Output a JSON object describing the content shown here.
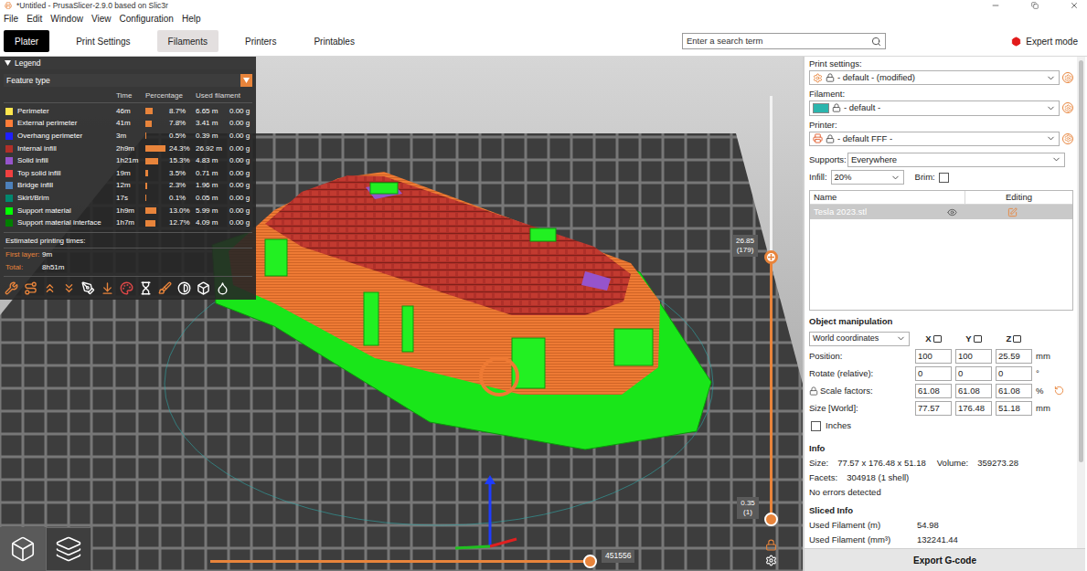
{
  "window": {
    "title": "*Untitled - PrusaSlicer-2.9.0 based on Slic3r"
  },
  "menu": [
    "File",
    "Edit",
    "Window",
    "View",
    "Configuration",
    "Help"
  ],
  "tabs": [
    {
      "label": "Plater",
      "selected": true,
      "hovered": false
    },
    {
      "label": "Print Settings",
      "selected": false,
      "hovered": false
    },
    {
      "label": "Filaments",
      "selected": false,
      "hovered": true
    },
    {
      "label": "Printers",
      "selected": false,
      "hovered": false
    },
    {
      "label": "Printables",
      "selected": false,
      "hovered": false
    }
  ],
  "search": {
    "placeholder": "Enter a search term"
  },
  "mode": "Expert mode",
  "legend": {
    "title": "Legend",
    "view": "Feature type",
    "columns": [
      "Time",
      "Percentage",
      "Used filament"
    ],
    "rows": [
      {
        "name": "Perimeter",
        "time": "46m",
        "percentage": "8.7%",
        "level": 0.087,
        "length": "6.65 m",
        "weight": "0.00 g",
        "color": "#ffe64d"
      },
      {
        "name": "External perimeter",
        "time": "41m",
        "percentage": "7.8%",
        "level": 0.078,
        "length": "3.41 m",
        "weight": "0.00 g",
        "color": "#ff7d38"
      },
      {
        "name": "Overhang perimeter",
        "time": "3m",
        "percentage": "0.5%",
        "level": 0.005,
        "length": "0.39 m",
        "weight": "0.00 g",
        "color": "#1f1fff"
      },
      {
        "name": "Internal infill",
        "time": "2h9m",
        "percentage": "24.3%",
        "level": 0.243,
        "length": "26.92 m",
        "weight": "0.00 g",
        "color": "#b03029"
      },
      {
        "name": "Solid infill",
        "time": "1h21m",
        "percentage": "15.3%",
        "level": 0.153,
        "length": "4.83 m",
        "weight": "0.00 g",
        "color": "#9654cc"
      },
      {
        "name": "Top solid infill",
        "time": "19m",
        "percentage": "3.5%",
        "level": 0.035,
        "length": "0.71 m",
        "weight": "0.00 g",
        "color": "#f04040"
      },
      {
        "name": "Bridge infill",
        "time": "12m",
        "percentage": "2.3%",
        "level": 0.023,
        "length": "1.96 m",
        "weight": "0.00 g",
        "color": "#4d80ba"
      },
      {
        "name": "Skirt/Brim",
        "time": "17s",
        "percentage": "0.1%",
        "level": 0.001,
        "length": "0.05 m",
        "weight": "0.00 g",
        "color": "#00876e"
      },
      {
        "name": "Support material",
        "time": "1h9m",
        "percentage": "13.0%",
        "level": 0.13,
        "length": "5.99 m",
        "weight": "0.00 g",
        "color": "#00ff00"
      },
      {
        "name": "Support material interface",
        "time": "1h7m",
        "percentage": "12.7%",
        "level": 0.127,
        "length": "4.09 m",
        "weight": "0.00 g",
        "color": "#008000"
      }
    ],
    "estimated_title": "Estimated printing times:",
    "times": [
      {
        "label": "First layer:",
        "value": "9m"
      },
      {
        "label": "Total:",
        "value": "8h51m"
      }
    ]
  },
  "layer_slider": {
    "top_height": "26.85",
    "top_layer": "(179)",
    "bottom_height": "0.35",
    "bottom_layer": "(1)",
    "top_level": 0.62,
    "bottom_level": 0
  },
  "move_slider": {
    "value": "451556",
    "level": 1
  },
  "view_buttons": [
    {
      "kind": "3d",
      "selected": false
    },
    {
      "kind": "preview",
      "selected": true
    }
  ],
  "sidebar": {
    "presets": [
      {
        "label": "Print settings:",
        "value": "- default - (modified)",
        "kind": "print"
      },
      {
        "label": "Filament:",
        "value": "- default -",
        "kind": "filament",
        "color": "#2bb5ad"
      },
      {
        "label": "Printer:",
        "value": "- default FFF -",
        "kind": "printer"
      }
    ],
    "supports": {
      "label": "Supports:",
      "value": "Everywhere"
    },
    "infill": {
      "label": "Infill:",
      "value": "20%"
    },
    "brim": {
      "label": "Brim:",
      "checked": false
    },
    "object_list": {
      "columns": [
        "Name",
        "Editing"
      ],
      "rows": [
        {
          "name": "Tesla 2023.stl",
          "selected": true
        }
      ]
    },
    "manipulation": {
      "title": "Object manipulation",
      "coordinates": "World coordinates",
      "axes": [
        "X",
        "Y",
        "Z"
      ],
      "rows": [
        {
          "label": "Position:",
          "values": [
            "100",
            "100",
            "25.59"
          ],
          "unit": "mm",
          "kind": "plain"
        },
        {
          "label": "Rotate (relative):",
          "values": [
            "0",
            "0",
            "0"
          ],
          "unit": "°",
          "kind": "plain"
        },
        {
          "label": "Scale factors:",
          "values": [
            "61.08",
            "61.08",
            "61.08"
          ],
          "unit": "%",
          "kind": "scale"
        },
        {
          "label": "Size [World]:",
          "values": [
            "77.57",
            "176.48",
            "51.18"
          ],
          "unit": "mm",
          "kind": "plain"
        }
      ],
      "inches": {
        "label": "Inches",
        "checked": false
      }
    },
    "info": {
      "title": "Info",
      "lines": [
        [
          {
            "label": "Size:",
            "value": "77.57 x 176.48 x 51.18"
          },
          {
            "label": "Volume:",
            "value": "359273.28"
          }
        ],
        [
          {
            "label": "Facets:",
            "value": "304918 (1 shell)"
          }
        ]
      ],
      "status": "No errors detected"
    },
    "sliced_info": {
      "title": "Sliced Info",
      "items": [
        {
          "label": "Used Filament (m)",
          "value": "54.98"
        },
        {
          "label": "Used Filament (mm³)",
          "value": "132241.44"
        }
      ]
    },
    "export": "Export G-code"
  }
}
